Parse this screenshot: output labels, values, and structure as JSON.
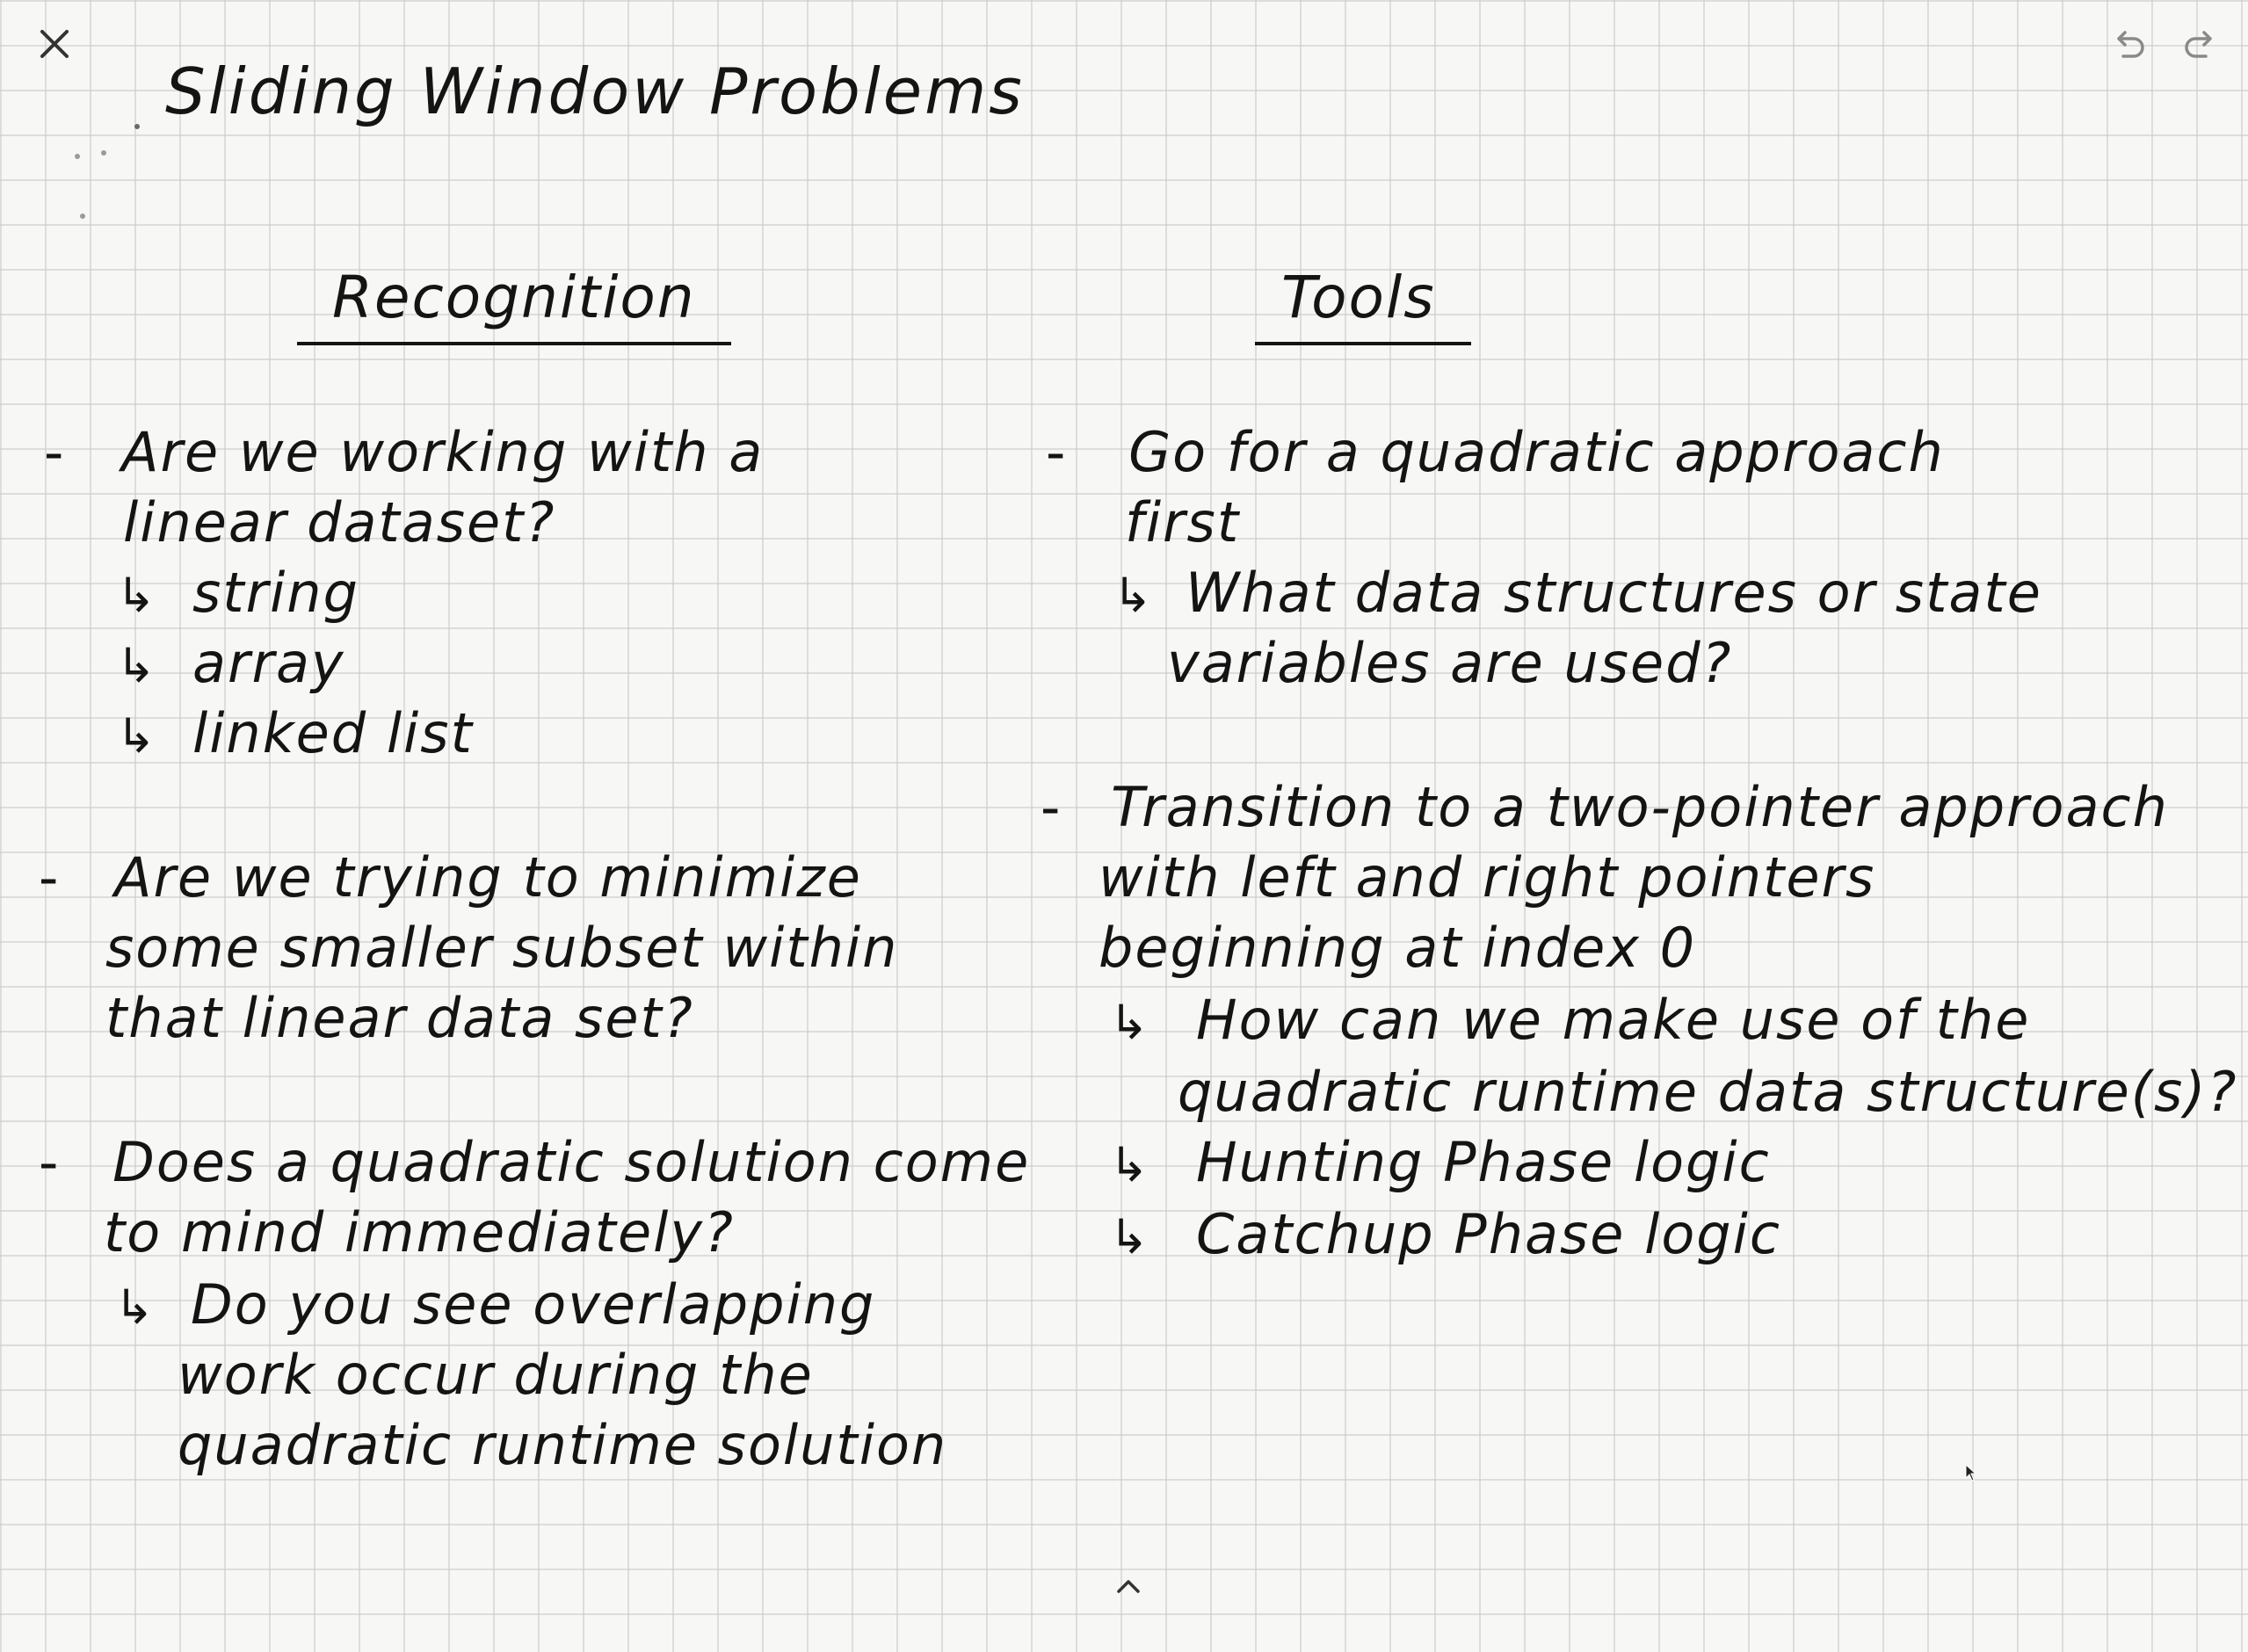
{
  "toolbar": {
    "close_icon": "close-icon",
    "undo_icon": "undo-icon",
    "redo_icon": "redo-icon",
    "expand_icon": "chevron-up-icon"
  },
  "note": {
    "title": "Sliding Window Problems",
    "left_column": {
      "heading": "Recognition",
      "lines": [
        {
          "prefix": "-",
          "text": "Are we working with a"
        },
        {
          "prefix": "",
          "text": "linear dataset?"
        },
        {
          "prefix": "↳",
          "text": "string"
        },
        {
          "prefix": "↳",
          "text": "array"
        },
        {
          "prefix": "↳",
          "text": "linked list"
        },
        {
          "prefix": "-",
          "text": "Are we trying to minimize"
        },
        {
          "prefix": "",
          "text": "some smaller subset within"
        },
        {
          "prefix": "",
          "text": "that linear data set?"
        },
        {
          "prefix": "-",
          "text": "Does a quadratic solution come"
        },
        {
          "prefix": "",
          "text": "to mind immediately?"
        },
        {
          "prefix": "↳",
          "text": "Do you see overlapping"
        },
        {
          "prefix": "",
          "text": "work occur during the"
        },
        {
          "prefix": "",
          "text": "quadratic runtime solution"
        }
      ]
    },
    "right_column": {
      "heading": "Tools",
      "lines": [
        {
          "prefix": "-",
          "text": "Go for a quadratic approach"
        },
        {
          "prefix": "",
          "text": "first"
        },
        {
          "prefix": "↳",
          "text": "What data structures or state"
        },
        {
          "prefix": "",
          "text": "variables are used?"
        },
        {
          "prefix": "-",
          "text": "Transition to a two-pointer approach"
        },
        {
          "prefix": "",
          "text": "with left and right pointers"
        },
        {
          "prefix": "",
          "text": "beginning at index 0"
        },
        {
          "prefix": "↳",
          "text": "How can we make use of the"
        },
        {
          "prefix": "",
          "text": "quadratic runtime data structure(s)?"
        },
        {
          "prefix": "↳",
          "text": "Hunting Phase logic"
        },
        {
          "prefix": "↳",
          "text": "Catchup Phase logic"
        }
      ]
    }
  },
  "colors": {
    "paper": "#f7f7f5",
    "grid": "#d6d6d3",
    "ink": "#141414",
    "ui_icon": "#555555"
  }
}
